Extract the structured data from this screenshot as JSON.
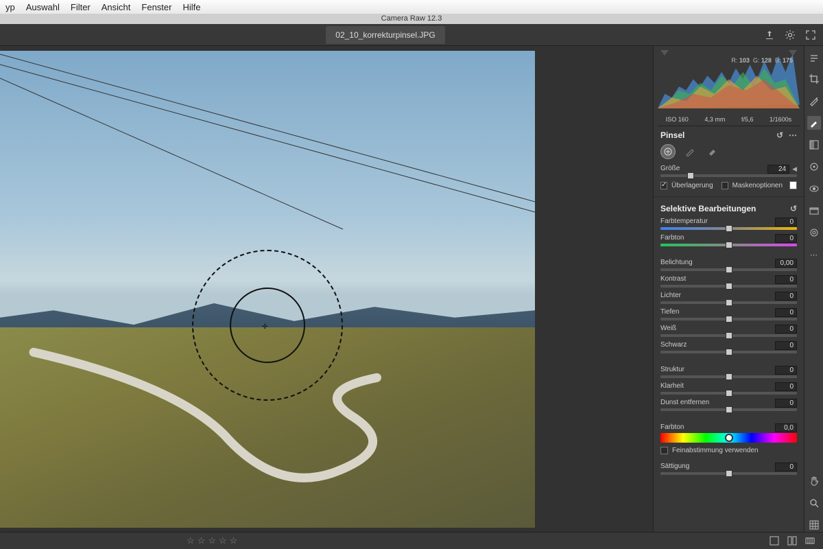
{
  "menu": {
    "items": [
      "yp",
      "Auswahl",
      "Filter",
      "Ansicht",
      "Fenster",
      "Hilfe"
    ]
  },
  "app_title": "Camera Raw 12.3",
  "doc_tab": "02_10_korrekturpinsel.JPG",
  "rgb": {
    "r_label": "R:",
    "r": "103",
    "g_label": "G:",
    "g": "128",
    "b_label": "B:",
    "b": "175"
  },
  "meta": {
    "iso": "ISO 160",
    "focal": "4,3 mm",
    "aperture": "f/5,6",
    "shutter": "1/1600s"
  },
  "brush": {
    "title": "Pinsel",
    "size_label": "Größe",
    "size_value": "24",
    "overlay_label": "Überlagerung",
    "mask_label": "Maskenoptionen"
  },
  "selective": {
    "title": "Selektive Bearbeitungen",
    "sliders": {
      "farbtemperatur": {
        "label": "Farbtemperatur",
        "value": "0"
      },
      "farbton1": {
        "label": "Farbton",
        "value": "0"
      },
      "belichtung": {
        "label": "Belichtung",
        "value": "0,00"
      },
      "kontrast": {
        "label": "Kontrast",
        "value": "0"
      },
      "lichter": {
        "label": "Lichter",
        "value": "0"
      },
      "tiefen": {
        "label": "Tiefen",
        "value": "0"
      },
      "weiss": {
        "label": "Weiß",
        "value": "0"
      },
      "schwarz": {
        "label": "Schwarz",
        "value": "0"
      },
      "struktur": {
        "label": "Struktur",
        "value": "0"
      },
      "klarheit": {
        "label": "Klarheit",
        "value": "0"
      },
      "dunst": {
        "label": "Dunst entfernen",
        "value": "0"
      },
      "farbton2": {
        "label": "Farbton",
        "value": "0,0"
      },
      "saettigung": {
        "label": "Sättigung",
        "value": "0"
      }
    },
    "fine_tune_label": "Feinabstimmung verwenden"
  }
}
